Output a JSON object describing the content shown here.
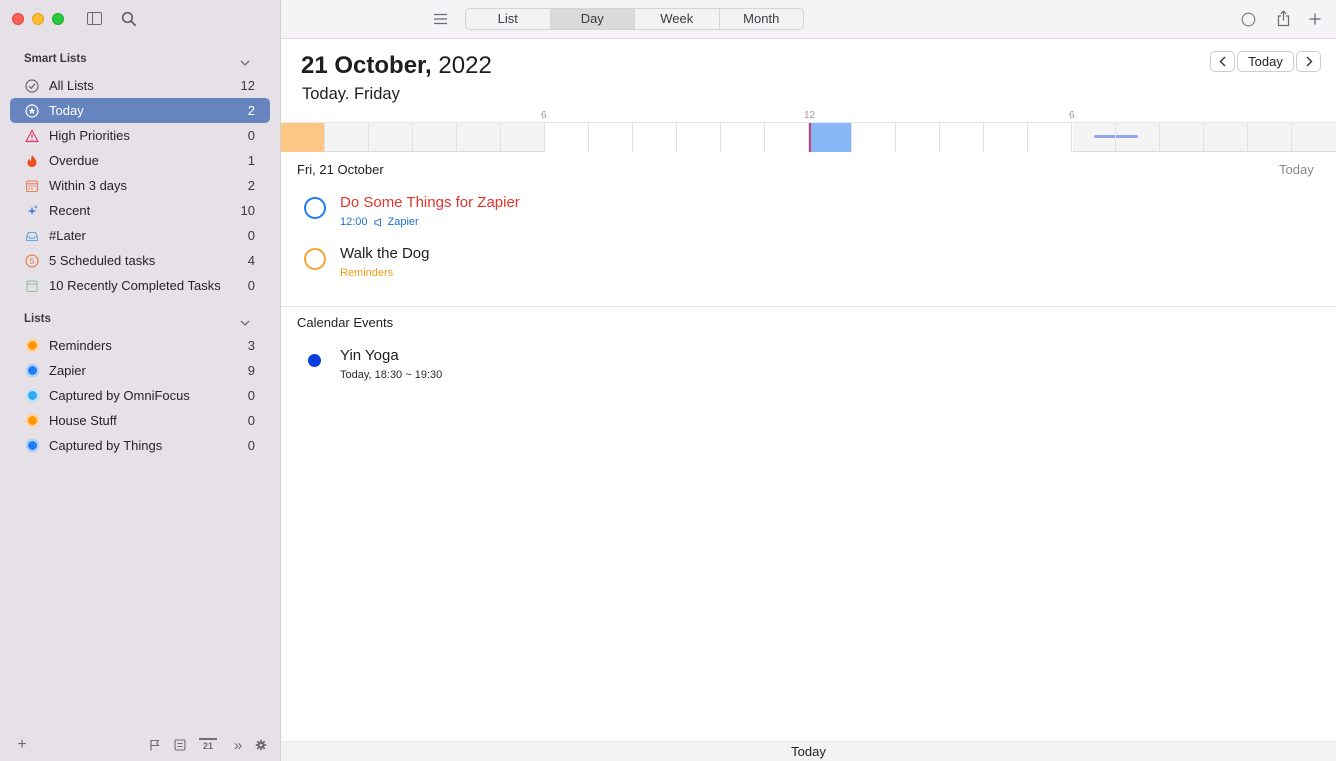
{
  "window": {
    "traffic_lights": [
      "close",
      "minimize",
      "zoom"
    ]
  },
  "sidebar": {
    "smart_lists_header": "Smart Lists",
    "smart_lists": [
      {
        "label": "All Lists",
        "count": "12",
        "icon": "checkmark-circle-icon"
      },
      {
        "label": "Today",
        "count": "2",
        "icon": "star-circle-icon",
        "active": true
      },
      {
        "label": "High Priorities",
        "count": "0",
        "icon": "warning-triangle-icon"
      },
      {
        "label": "Overdue",
        "count": "1",
        "icon": "flame-icon"
      },
      {
        "label": "Within 3 days",
        "count": "2",
        "icon": "calendar-grid-icon"
      },
      {
        "label": "Recent",
        "count": "10",
        "icon": "sparkle-icon"
      },
      {
        "label": "#Later",
        "count": "0",
        "icon": "tray-icon"
      },
      {
        "label": "5 Scheduled tasks",
        "count": "4",
        "icon": "numbered-clock-icon"
      },
      {
        "label": "10 Recently Completed Tasks",
        "count": "0",
        "icon": "completed-tray-icon"
      }
    ],
    "lists_header": "Lists",
    "lists": [
      {
        "label": "Reminders",
        "count": "3",
        "color": "#ff9500"
      },
      {
        "label": "Zapier",
        "count": "9",
        "color": "#1f7cf5"
      },
      {
        "label": "Captured by OmniFocus",
        "count": "0",
        "color": "#30aaf2"
      },
      {
        "label": "House Stuff",
        "count": "0",
        "color": "#ff9500"
      },
      {
        "label": "Captured by Things",
        "count": "0",
        "color": "#1f7cf5"
      }
    ],
    "bottom_bar": {
      "add": "+",
      "calendar_day": "21",
      "more": "»"
    }
  },
  "toolbar": {
    "view_tabs": [
      "List",
      "Day",
      "Week",
      "Month"
    ],
    "selected_tab": "Day"
  },
  "header": {
    "date_bold": "21 October,",
    "year": " 2022",
    "subtitle": "Today. Friday",
    "today_button": "Today"
  },
  "timeline": {
    "tick_labels": [
      "6",
      "12",
      "6"
    ],
    "colors": {
      "morning": "#fcc784",
      "current": "#88b7f7",
      "event": "#8ea5e8",
      "now_line": "#c2407c"
    }
  },
  "day_section": {
    "header": "Fri, 21 October",
    "today_label": "Today",
    "tasks": [
      {
        "title": "Do Some Things for Zapier",
        "time": "12:00",
        "list": "Zapier",
        "title_color": "#e0352b",
        "ring_color": "#1f7cf5",
        "meta_color": "#1f6fd6"
      },
      {
        "title": "Walk the Dog",
        "list": "Reminders",
        "title_color": "#1e1e1e",
        "ring_color": "#f7a137",
        "meta_color": "#f09a1a"
      }
    ]
  },
  "calendar_section": {
    "header": "Calendar Events",
    "events": [
      {
        "title": "Yin Yoga",
        "time": "Today, 18:30 ~ 19:30",
        "color": "#0a3fdb"
      }
    ]
  },
  "footer": {
    "label": "Today"
  }
}
